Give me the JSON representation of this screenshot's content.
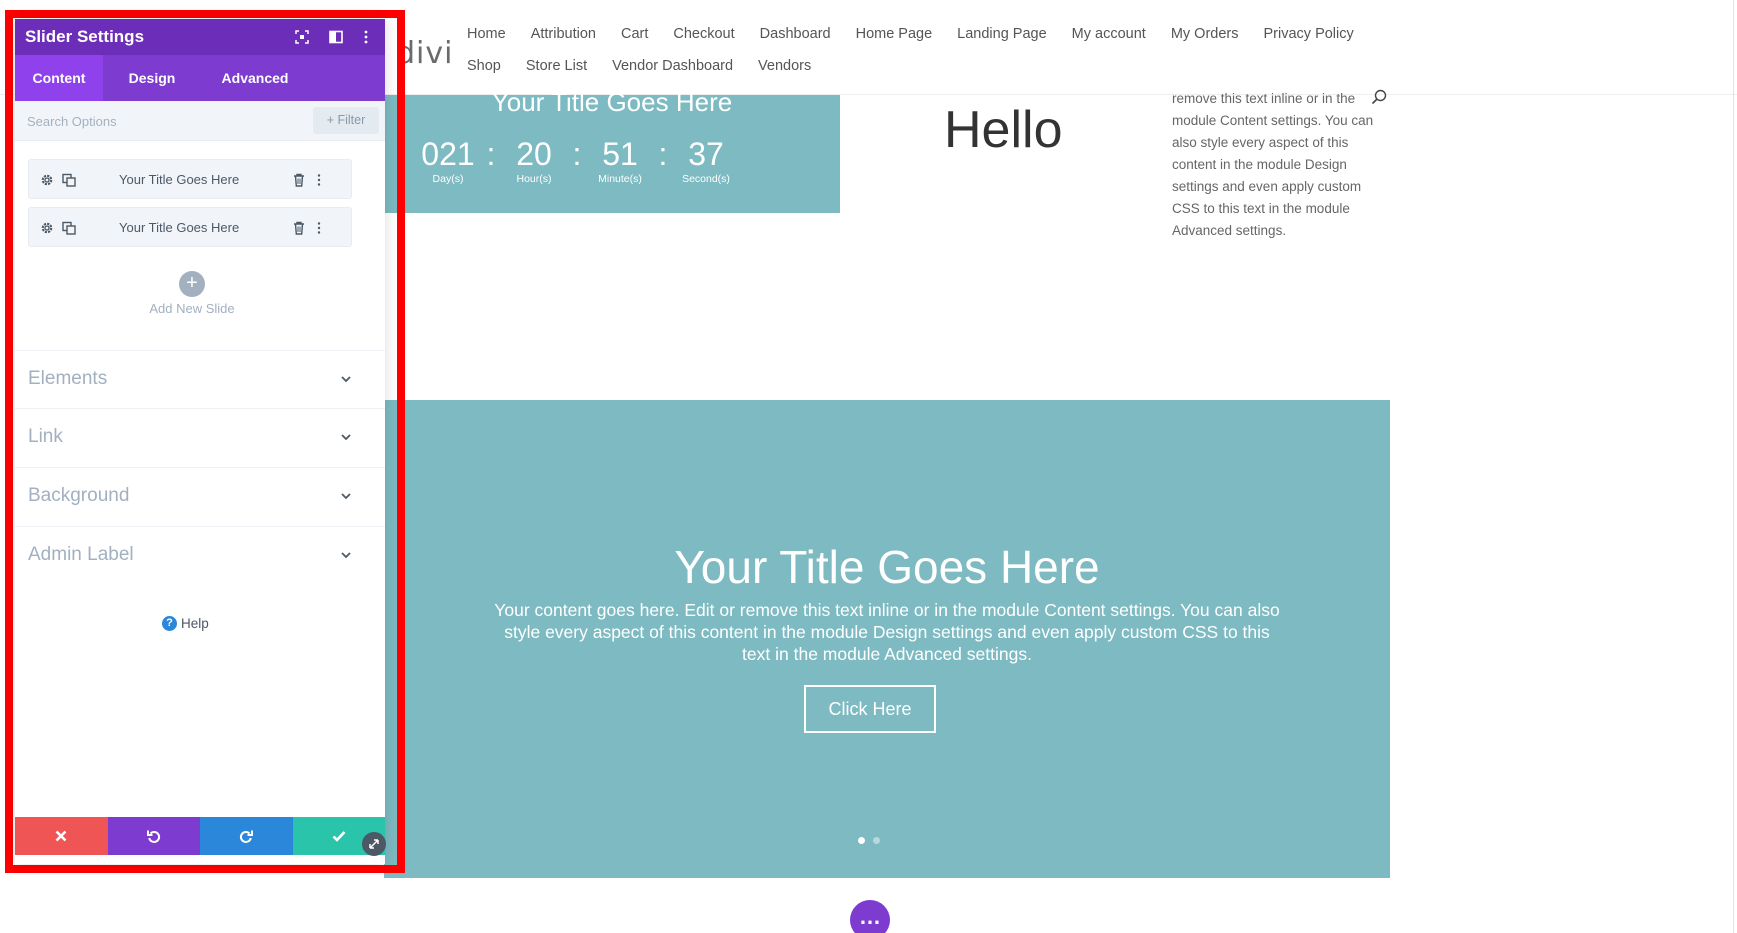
{
  "site": {
    "logo": "divi",
    "nav_row1": [
      "Home",
      "Attribution",
      "Cart",
      "Checkout",
      "Dashboard",
      "Home Page",
      "Landing Page",
      "My account",
      "My Orders",
      "Privacy Policy"
    ],
    "nav_row2": [
      "Shop",
      "Store List",
      "Vendor Dashboard",
      "Vendors"
    ],
    "countdown": {
      "title": "Your Title Goes Here",
      "days": "021",
      "days_label": "Day(s)",
      "hours": "20",
      "hours_label": "Hour(s)",
      "minutes": "51",
      "minutes_label": "Minute(s)",
      "seconds": "37",
      "seconds_label": "Second(s)",
      "separator": ":"
    },
    "hello": "Hello",
    "side_text": "remove this text inline or in the module Content settings. You can also style every aspect of this content in the module Design settings and even apply custom CSS to this text in the module Advanced settings.",
    "slider": {
      "title": "Your Title Goes Here",
      "content": "Your content goes here. Edit or remove this text inline or in the module Content settings. You can also style every aspect of this content in the module Design settings and even apply custom CSS to this text in the module Advanced settings.",
      "button": "Click Here",
      "active_slide": 1,
      "slide_count": 2
    },
    "more_button": "…"
  },
  "panel": {
    "title": "Slider Settings",
    "tabs": [
      "Content",
      "Design",
      "Advanced"
    ],
    "active_tab": "Content",
    "search_placeholder": "Search Options",
    "filter_label": "+ Filter",
    "slides": [
      "Your Title Goes Here",
      "Your Title Goes Here"
    ],
    "add_slide_label": "Add New Slide",
    "groups": [
      "Elements",
      "Link",
      "Background",
      "Admin Label"
    ],
    "help_label": "Help"
  },
  "colors": {
    "panel_header": "#6c2eb9",
    "panel_tabs": "#7e3bd0",
    "panel_tab_active": "#8f42ec",
    "teal": "#7dbac2",
    "cancel": "#ef5555",
    "undo": "#7e3bd0",
    "redo": "#2b87da",
    "save": "#29c4a9",
    "frame_red": "#ff0000"
  },
  "icons": [
    "fullscreen-icon",
    "split-view-icon",
    "more-vertical-icon",
    "gear-icon",
    "copy-icon",
    "trash-icon",
    "plus-icon",
    "chevron-down-icon",
    "help-icon",
    "close-icon",
    "undo-icon",
    "redo-icon",
    "check-icon",
    "resize-icon",
    "search-icon"
  ]
}
